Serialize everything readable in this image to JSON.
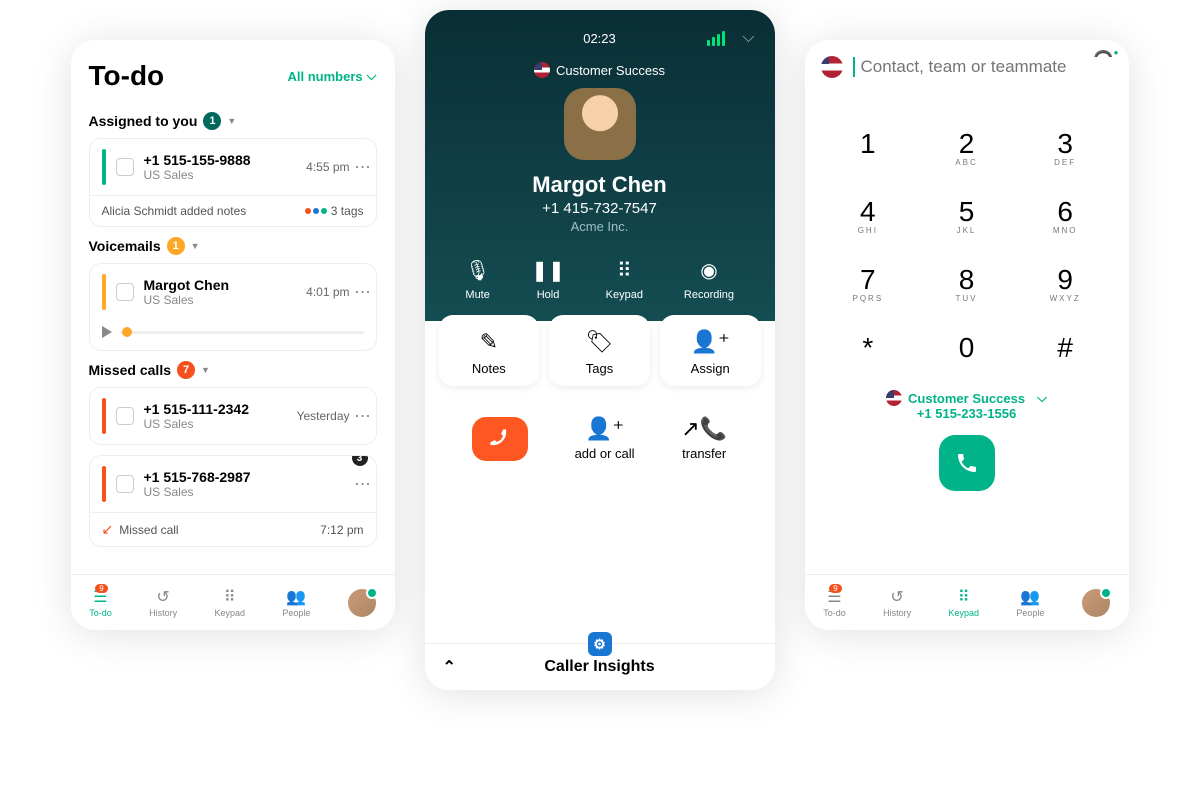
{
  "todo": {
    "title": "To-do",
    "filter": "All numbers",
    "sections": {
      "assigned": {
        "label": "Assigned to you",
        "count": "1"
      },
      "voicemails": {
        "label": "Voicemails",
        "count": "1"
      },
      "missed": {
        "label": "Missed calls",
        "count": "7"
      }
    },
    "assigned_item": {
      "number": "+1 515-155-9888",
      "source": "US Sales",
      "time": "4:55 pm",
      "note": "Alicia Schmidt added notes",
      "tags": "3 tags"
    },
    "vm_item": {
      "name": "Margot Chen",
      "source": "US Sales",
      "time": "4:01 pm"
    },
    "missed1": {
      "number": "+1 515-111-2342",
      "source": "US Sales",
      "time": "Yesterday"
    },
    "missed2": {
      "number": "+1 515-768-2987",
      "source": "US Sales",
      "badge": "3",
      "footer_label": "Missed call",
      "footer_time": "7:12 pm"
    },
    "tabs": {
      "todo": "To-do",
      "todo_badge": "9",
      "history": "History",
      "keypad": "Keypad",
      "people": "People"
    }
  },
  "call": {
    "timer": "02:23",
    "dept": "Customer Success",
    "name": "Margot Chen",
    "phone": "+1 415-732-7547",
    "company": "Acme Inc.",
    "controls": {
      "mute": "Mute",
      "hold": "Hold",
      "keypad": "Keypad",
      "recording": "Recording"
    },
    "cards": {
      "notes": "Notes",
      "tags": "Tags",
      "assign": "Assign"
    },
    "actions": {
      "add": "add or call",
      "transfer": "transfer"
    },
    "footer": "Caller Insights"
  },
  "dialer": {
    "placeholder": "Contact, team or teammate",
    "keys": [
      {
        "n": "1",
        "s": ""
      },
      {
        "n": "2",
        "s": "ABC"
      },
      {
        "n": "3",
        "s": "DEF"
      },
      {
        "n": "4",
        "s": "GHI"
      },
      {
        "n": "5",
        "s": "JKL"
      },
      {
        "n": "6",
        "s": "MNO"
      },
      {
        "n": "7",
        "s": "PQRS"
      },
      {
        "n": "8",
        "s": "TUV"
      },
      {
        "n": "9",
        "s": "WXYZ"
      },
      {
        "n": "*",
        "s": ""
      },
      {
        "n": "0",
        "s": ""
      },
      {
        "n": "#",
        "s": ""
      }
    ],
    "dept": "Customer Success",
    "dept_num": "+1 515-233-1556",
    "tabs": {
      "todo": "To-do",
      "todo_badge": "9",
      "history": "History",
      "keypad": "Keypad",
      "people": "People"
    }
  }
}
